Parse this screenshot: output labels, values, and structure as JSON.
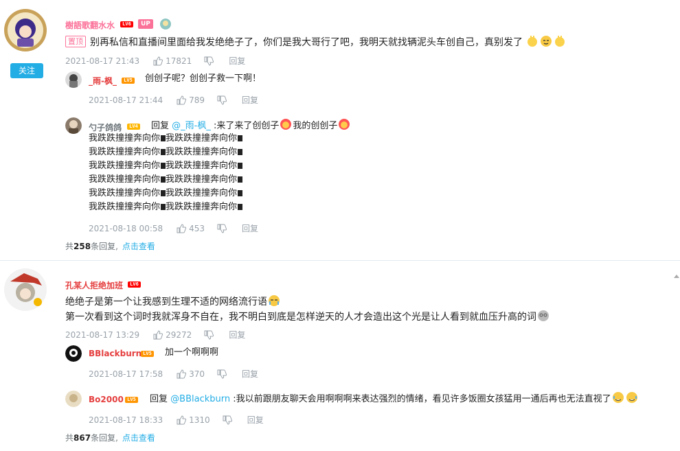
{
  "follow_label": "关注",
  "reply_label": "回复",
  "comments": [
    {
      "username": "樹語歌翻水水",
      "level": "LV6",
      "up_badge": "UP",
      "pin_label": "置顶",
      "text": "别再私信和直播间里面给我发绝绝子了，你们是我大哥行了吧，我明天就找辆泥头车创自己，真别发了",
      "time": "2021-08-17 21:43",
      "likes": "17821",
      "replies": [
        {
          "username": "_雨-枫_",
          "level": "LV5",
          "text": "创创子呢？创创子救一下啊！",
          "time": "2021-08-17 21:44",
          "likes": "789"
        },
        {
          "username": "勺子鸽鸽",
          "level": "LV4",
          "reply_prefix": "回复",
          "mention": "@_雨-枫_",
          "text_a": ":来了来了创创子",
          "text_b": "我的创创子",
          "repeat_line": "我跌跌撞撞奔向你",
          "time": "2021-08-18 00:58",
          "likes": "453"
        }
      ],
      "summary_prefix": "共",
      "summary_count": "258",
      "summary_suffix": "条回复,",
      "summary_link": "点击查看"
    },
    {
      "username": "孔某人拒绝加班",
      "level": "LV6",
      "text_line1": "绝绝子是第一个让我感到生理不适的网络流行语",
      "text_line2": "第一次看到这个词时我就浑身不自在，我不明白到底是怎样逆天的人才会造出这个光是让人看到就血压升高的词",
      "time": "2021-08-17 13:29",
      "likes": "29272",
      "replies": [
        {
          "username": "BBlackburn",
          "level": "LV5",
          "text": "加一个啊啊啊",
          "time": "2021-08-17 17:58",
          "likes": "370"
        },
        {
          "username": "Bo2000",
          "level": "LV5",
          "reply_prefix": "回复",
          "mention": "@BBlackburn",
          "text": ":我以前跟朋友聊天会用啊啊啊来表达强烈的情绪，看见许多饭圈女孩猛用一通后再也无法直视了",
          "time": "2021-08-17 18:33",
          "likes": "1310"
        }
      ],
      "summary_prefix": "共",
      "summary_count": "867",
      "summary_suffix": "条回复,",
      "summary_link": "点击查看"
    }
  ]
}
